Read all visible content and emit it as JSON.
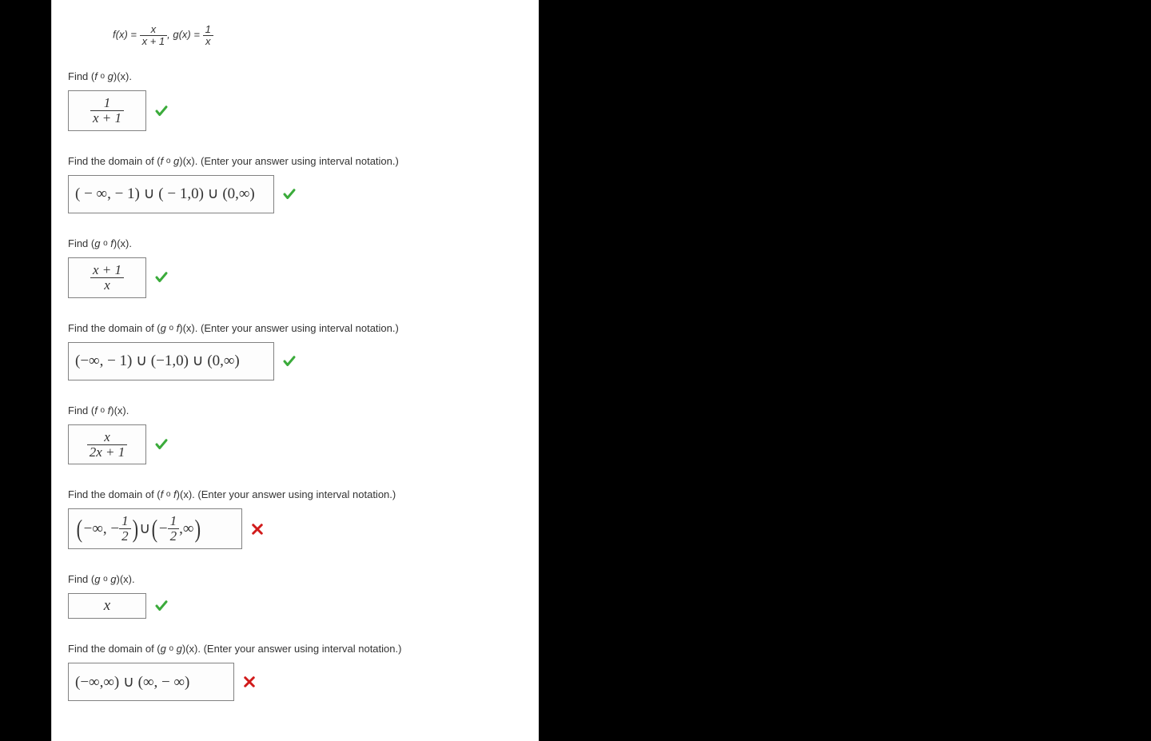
{
  "definitions": {
    "f_label": "f(x) = ",
    "f_num": "x",
    "f_den": "x + 1",
    "sep": ",    ",
    "g_label": "g(x) = ",
    "g_num": "1",
    "g_den": "x"
  },
  "prompts": {
    "fog": "Find  (f ∘ g)(x).",
    "fog_label_pre": "Find  (",
    "fog_label_f": "f ",
    "fog_label_g": " g",
    "fog_label_post": ")(x).",
    "domain_fog_pre": "Find the domain of  (",
    "domain_post_x": ")(x).  ",
    "interval_hint": "(Enter your answer using interval notation.)",
    "gof_g": "g ",
    "gof_f": " f",
    "fof_f1": "f ",
    "fof_f2": " f",
    "gog_g1": "g ",
    "gog_g2": " g",
    "circ": "o"
  },
  "answers": {
    "fog_num": "1",
    "fog_den": "x + 1",
    "domain_fog": "( − ∞, − 1) ∪ ( − 1,0) ∪ (0,∞)",
    "gof_num": "x + 1",
    "gof_den": "x",
    "domain_gof": "(−∞, − 1) ∪ (−1,0) ∪ (0,∞)",
    "fof_num": "x",
    "fof_den": "2x + 1",
    "domain_fof_a_pre": "−∞, − ",
    "domain_fof_a_num": "1",
    "domain_fof_a_den": "2",
    "domain_fof_union": " ∪ ",
    "domain_fof_b_pre": "− ",
    "domain_fof_b_num": "1",
    "domain_fof_b_den": "2",
    "domain_fof_b_post": ",∞",
    "gog": "x",
    "domain_gog": "(−∞,∞) ∪ (∞, − ∞)"
  },
  "marks": {
    "correct": "correct",
    "incorrect": "incorrect"
  }
}
